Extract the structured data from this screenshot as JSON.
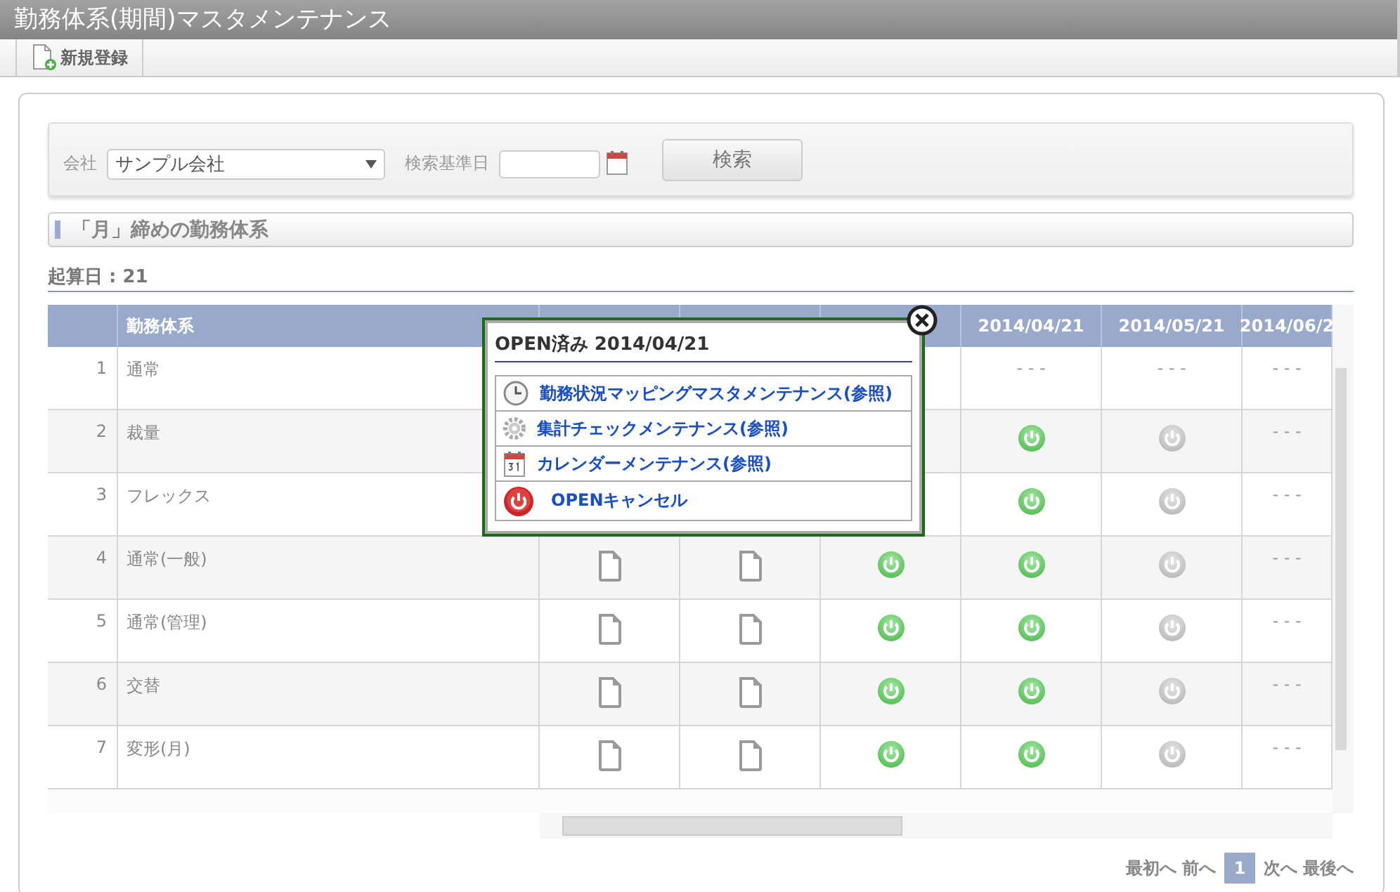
{
  "window": {
    "title": "勤務体系(期間)マスタメンテナンス"
  },
  "toolbar": {
    "buttons": [
      {
        "label": "新規登録"
      }
    ]
  },
  "search": {
    "company_label": "会社",
    "company_value": "サンプル会社",
    "date_label": "検索基準日",
    "button": "検索"
  },
  "section": {
    "title": "「月」締めの勤務体系"
  },
  "start_day": "起算日 : 21",
  "table": {
    "name_column": "勤務体系",
    "date_columns": [
      {
        "kind": "covered"
      },
      {
        "kind": "covered"
      },
      {
        "kind": "covered"
      },
      {
        "kind": "date",
        "label": "2014/04/21"
      },
      {
        "kind": "date",
        "label": "2014/05/21"
      },
      {
        "kind": "date",
        "label": "2014/06/2"
      }
    ],
    "rows": [
      {
        "number": "1",
        "name": "通常",
        "cells": [
          {
            "kind": "covered"
          },
          {
            "kind": "covered"
          },
          {
            "kind": "covered"
          },
          {
            "kind": "none",
            "text": "- - -"
          },
          {
            "kind": "none",
            "text": "- - -"
          },
          {
            "kind": "none",
            "text": "- - -"
          }
        ]
      },
      {
        "number": "2",
        "name": "裁量",
        "cells": [
          {
            "kind": "covered"
          },
          {
            "kind": "covered"
          },
          {
            "kind": "covered"
          },
          {
            "kind": "open"
          },
          {
            "kind": "closed"
          },
          {
            "kind": "none",
            "text": "- - -"
          }
        ]
      },
      {
        "number": "3",
        "name": "フレックス",
        "cells": [
          {
            "kind": "covered"
          },
          {
            "kind": "covered"
          },
          {
            "kind": "covered"
          },
          {
            "kind": "open"
          },
          {
            "kind": "closed"
          },
          {
            "kind": "none",
            "text": "- - -"
          }
        ]
      },
      {
        "number": "4",
        "name": "通常(一般)",
        "cells": [
          {
            "kind": "document"
          },
          {
            "kind": "document"
          },
          {
            "kind": "open"
          },
          {
            "kind": "open"
          },
          {
            "kind": "closed"
          },
          {
            "kind": "none",
            "text": "- - -"
          }
        ]
      },
      {
        "number": "5",
        "name": "通常(管理)",
        "cells": [
          {
            "kind": "document"
          },
          {
            "kind": "document"
          },
          {
            "kind": "open"
          },
          {
            "kind": "open"
          },
          {
            "kind": "closed"
          },
          {
            "kind": "none",
            "text": "- - -"
          }
        ]
      },
      {
        "number": "6",
        "name": "交替",
        "cells": [
          {
            "kind": "document"
          },
          {
            "kind": "document"
          },
          {
            "kind": "open"
          },
          {
            "kind": "open"
          },
          {
            "kind": "closed"
          },
          {
            "kind": "none",
            "text": "- - -"
          }
        ]
      },
      {
        "number": "7",
        "name": "変形(月)",
        "cells": [
          {
            "kind": "document"
          },
          {
            "kind": "document"
          },
          {
            "kind": "open"
          },
          {
            "kind": "open"
          },
          {
            "kind": "closed"
          },
          {
            "kind": "none",
            "text": "- - -"
          }
        ]
      }
    ]
  },
  "popup": {
    "title": "OPEN済み 2014/04/21",
    "items": [
      {
        "kind": "clock",
        "label": "勤務状況マッピングマスタメンテナンス(参照)"
      },
      {
        "kind": "gear",
        "label": "集計チェックメンテナンス(参照)"
      },
      {
        "kind": "calendar",
        "label": "カレンダーメンテナンス(参照)"
      },
      {
        "kind": "power",
        "label": "OPENキャンセル"
      }
    ]
  },
  "pager": {
    "items": [
      {
        "kind": "link",
        "label": "最初へ"
      },
      {
        "kind": "link",
        "label": "前へ"
      },
      {
        "kind": "page",
        "label": "1",
        "selected": true
      },
      {
        "kind": "link",
        "label": "次へ"
      },
      {
        "kind": "link",
        "label": "最後へ"
      }
    ]
  }
}
